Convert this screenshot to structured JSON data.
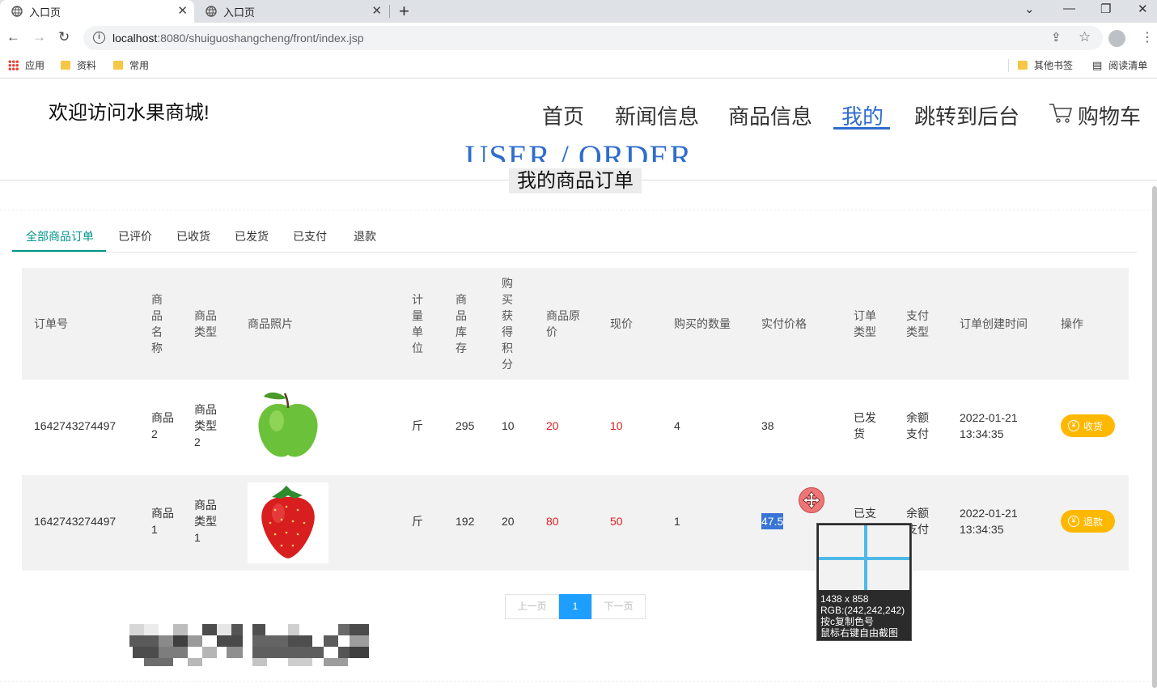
{
  "browser": {
    "tabs": [
      {
        "title": "入口页",
        "active": true
      },
      {
        "title": "入口页",
        "active": false
      }
    ],
    "url_host": "localhost",
    "url_rest": ":8080/shuiguoshangcheng/front/index.jsp",
    "bookmarks": [
      "应用",
      "资料",
      "常用"
    ],
    "bookmarks_right": [
      "其他书签",
      "阅读清单"
    ]
  },
  "header": {
    "welcome": "欢迎访问水果商城!",
    "menu": [
      "首页",
      "新闻信息",
      "商品信息",
      "我的",
      "跳转到后台",
      "购物车"
    ],
    "active_menu": "我的"
  },
  "page": {
    "en_title": "USER / ORDER",
    "cn_title": "我的商品订单"
  },
  "order_tabs": [
    "全部商品订单",
    "已评价",
    "已收货",
    "已发货",
    "已支付",
    "退款"
  ],
  "table": {
    "headers": {
      "order_no": "订单号",
      "name": "商品名称",
      "type": "商品类型",
      "photo": "商品照片",
      "unit": "计量单位",
      "stock": "商品库存",
      "points": "购买获得积分",
      "orig_price": "商品原价",
      "price": "现价",
      "qty": "购买的数量",
      "paid": "实付价格",
      "order_type": "订单类型",
      "pay_type": "支付类型",
      "created": "订单创建时间",
      "action": "操作"
    },
    "rows": [
      {
        "order_no": "1642743274497",
        "name": "商品2",
        "type": "商品类型2",
        "photo": "green-apple",
        "unit": "斤",
        "stock": "295",
        "points": "10",
        "orig_price": "20",
        "price": "10",
        "qty": "4",
        "paid": "38",
        "order_type": "已发货",
        "pay_type": "余额支付",
        "created_date": "2022-01-21",
        "created_time": "13:34:35",
        "action": "收货"
      },
      {
        "order_no": "1642743274497",
        "name": "商品1",
        "type": "商品类型1",
        "photo": "strawberry",
        "unit": "斤",
        "stock": "192",
        "points": "20",
        "orig_price": "80",
        "price": "50",
        "qty": "1",
        "paid": "47.5",
        "order_type": "已支",
        "pay_type": "余额支付",
        "created_date": "2022-01-21",
        "created_time": "13:34:35",
        "action": "退款"
      }
    ]
  },
  "pager": {
    "prev": "上一页",
    "current": "1",
    "next": "下一页"
  },
  "overlay": {
    "size": "1438 x 858",
    "rgb": "RGB:(242,242,242)",
    "hint1": "按c复制色号",
    "hint2": "鼠标右键自由截图"
  },
  "colors": {
    "accent": "#2f6ccf",
    "tab_active": "#009688",
    "action_button": "#ffb800",
    "pager_current": "#1e9fff",
    "price_red": "#e02020"
  }
}
